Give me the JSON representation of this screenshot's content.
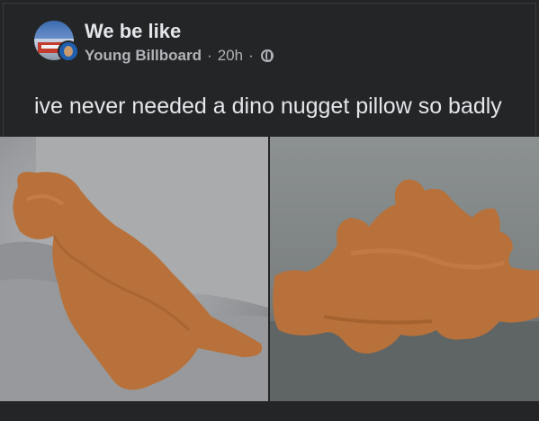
{
  "post": {
    "group_name": "We be like",
    "author": "Young Billboard",
    "time": "20h",
    "separator": "·",
    "privacy_icon": "globe-icon",
    "caption": "ive never needed a dino nugget pillow so badly"
  },
  "photos": [
    {
      "description_icon": "photo-dino-nugget-pillow-left"
    },
    {
      "description_icon": "photo-dino-nugget-pillow-right"
    }
  ],
  "colors": {
    "background": "#242526",
    "primary_text": "#e4e6eb",
    "secondary_text": "#b0b3b8",
    "nugget": "#b8713a"
  }
}
